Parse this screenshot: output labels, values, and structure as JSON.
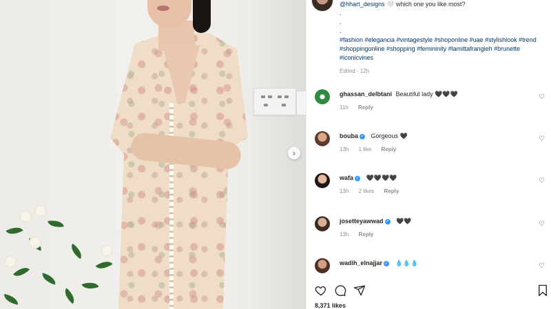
{
  "post": {
    "caption_handle": "@hhart_designs",
    "caption_text": "🤍 which one you like most?",
    "dots": [
      ".",
      ".",
      "."
    ],
    "hashtags": "#fashion #elegancia #vintagestyle #shoponline #uae #stylishlook #trend #shoppingonline #shopping #femininity #lamittafrangieh #brunette #iconicvines",
    "edited": "Edited · 12h",
    "likes": "8,371 likes"
  },
  "comments": [
    {
      "user": "ghassan_delbtani",
      "verified": false,
      "text": "Beautiful lady 🖤🖤🖤",
      "time": "11h",
      "likes": "",
      "reply": "Reply"
    },
    {
      "user": "bouba",
      "verified": true,
      "text": "Gorgeous 🖤",
      "time": "13h",
      "likes": "1 like",
      "reply": "Reply"
    },
    {
      "user": "wafa",
      "verified": true,
      "text": "🖤🖤🖤🖤",
      "time": "13h",
      "likes": "2 likes",
      "reply": "Reply"
    },
    {
      "user": "josetteyawwad",
      "verified": true,
      "text": "🖤🖤",
      "time": "13h",
      "likes": "",
      "reply": "Reply"
    },
    {
      "user": "wadih_elnajjar",
      "verified": true,
      "text": "💧💧💧",
      "time": "",
      "likes": "",
      "reply": ""
    }
  ],
  "icons": {
    "like": "heart-icon",
    "comment": "comment-icon",
    "share": "share-icon",
    "save": "bookmark-icon",
    "next": "chevron-right-icon"
  },
  "colors": {
    "link": "#00376b",
    "verified": "#3897f0",
    "muted": "#8e8e8e"
  }
}
